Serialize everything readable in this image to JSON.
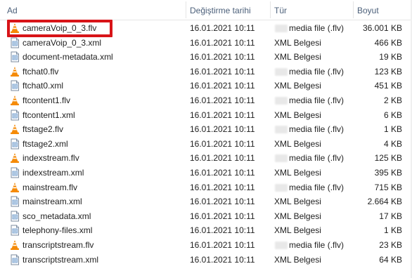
{
  "columns": {
    "name": "Ad",
    "date": "Değiştirme tarihi",
    "type": "Tür",
    "size": "Boyut"
  },
  "colors": {
    "vlc_orange": "#f58a07",
    "highlight": "#d81418",
    "header_text": "#4c607a"
  },
  "files": [
    {
      "name": "cameraVoip_0_3.flv",
      "date": "16.01.2021 10:11",
      "type": "media file (.flv)",
      "size": "36.001 KB",
      "icon": "vlc-cone-icon"
    },
    {
      "name": "cameraVoip_0_3.xml",
      "date": "16.01.2021 10:11",
      "type": "XML Belgesi",
      "size": "466 KB",
      "icon": "xml-document-icon"
    },
    {
      "name": "document-metadata.xml",
      "date": "16.01.2021 10:11",
      "type": "XML Belgesi",
      "size": "19 KB",
      "icon": "xml-document-icon"
    },
    {
      "name": "ftchat0.flv",
      "date": "16.01.2021 10:11",
      "type": "media file (.flv)",
      "size": "123 KB",
      "icon": "vlc-cone-icon"
    },
    {
      "name": "ftchat0.xml",
      "date": "16.01.2021 10:11",
      "type": "XML Belgesi",
      "size": "451 KB",
      "icon": "xml-document-icon"
    },
    {
      "name": "ftcontent1.flv",
      "date": "16.01.2021 10:11",
      "type": "media file (.flv)",
      "size": "2 KB",
      "icon": "vlc-cone-icon"
    },
    {
      "name": "ftcontent1.xml",
      "date": "16.01.2021 10:11",
      "type": "XML Belgesi",
      "size": "6 KB",
      "icon": "xml-document-icon"
    },
    {
      "name": "ftstage2.flv",
      "date": "16.01.2021 10:11",
      "type": "media file (.flv)",
      "size": "1 KB",
      "icon": "vlc-cone-icon"
    },
    {
      "name": "ftstage2.xml",
      "date": "16.01.2021 10:11",
      "type": "XML Belgesi",
      "size": "4 KB",
      "icon": "xml-document-icon"
    },
    {
      "name": "indexstream.flv",
      "date": "16.01.2021 10:11",
      "type": "media file (.flv)",
      "size": "125 KB",
      "icon": "vlc-cone-icon"
    },
    {
      "name": "indexstream.xml",
      "date": "16.01.2021 10:11",
      "type": "XML Belgesi",
      "size": "395 KB",
      "icon": "xml-document-icon"
    },
    {
      "name": "mainstream.flv",
      "date": "16.01.2021 10:11",
      "type": "media file (.flv)",
      "size": "715 KB",
      "icon": "vlc-cone-icon"
    },
    {
      "name": "mainstream.xml",
      "date": "16.01.2021 10:11",
      "type": "XML Belgesi",
      "size": "2.664 KB",
      "icon": "xml-document-icon"
    },
    {
      "name": "sco_metadata.xml",
      "date": "16.01.2021 10:11",
      "type": "XML Belgesi",
      "size": "17 KB",
      "icon": "xml-document-icon"
    },
    {
      "name": "telephony-files.xml",
      "date": "16.01.2021 10:11",
      "type": "XML Belgesi",
      "size": "1 KB",
      "icon": "xml-document-icon"
    },
    {
      "name": "transcriptstream.flv",
      "date": "16.01.2021 10:11",
      "type": "media file (.flv)",
      "size": "23 KB",
      "icon": "vlc-cone-icon"
    },
    {
      "name": "transcriptstream.xml",
      "date": "16.01.2021 10:11",
      "type": "XML Belgesi",
      "size": "64 KB",
      "icon": "xml-document-icon"
    }
  ]
}
